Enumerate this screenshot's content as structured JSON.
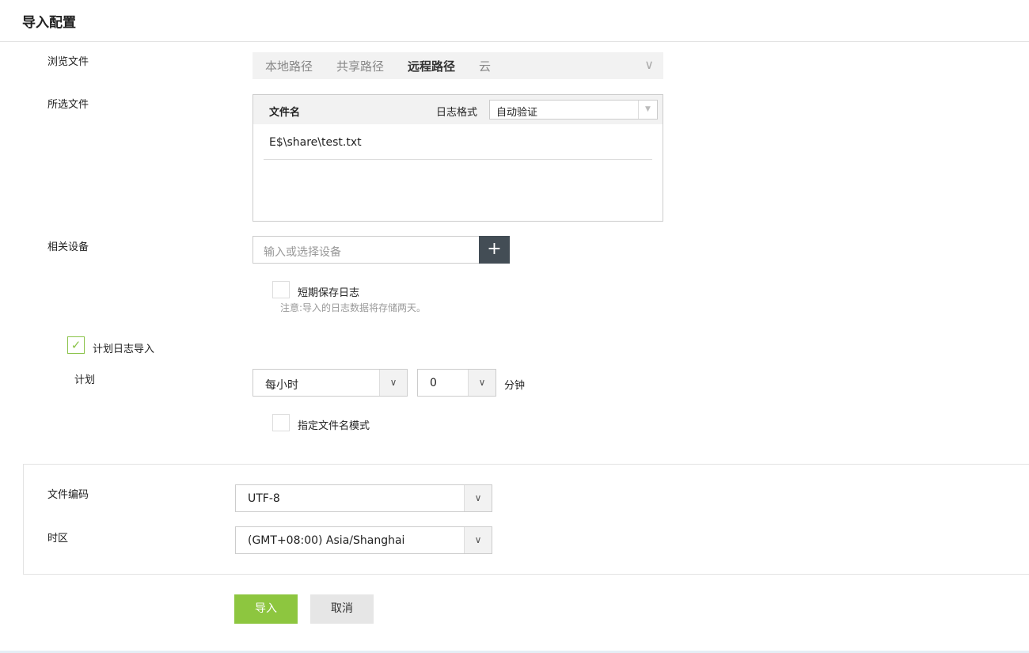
{
  "title": "导入配置",
  "labels": {
    "browse": "浏览文件",
    "selected": "所选文件",
    "device": "相关设备",
    "schedule": "计划",
    "encoding": "文件编码",
    "timezone": "时区"
  },
  "tabs": [
    {
      "label": "本地路径"
    },
    {
      "label": "共享路径"
    },
    {
      "label": "远程路径",
      "active": true
    },
    {
      "label": "云"
    }
  ],
  "file_table": {
    "col_filename": "文件名",
    "log_format_label": "日志格式",
    "log_format_value": "自动验证",
    "files": [
      "E$\\share\\test.txt"
    ]
  },
  "device_input": {
    "placeholder": "输入或选择设备",
    "value": ""
  },
  "short_term": {
    "label": "短期保存日志",
    "checked": false,
    "note": "注意:导入的日志数据将存储两天。"
  },
  "scheduled": {
    "label": "计划日志导入",
    "checked": true
  },
  "schedule": {
    "frequency": "每小时",
    "minute": "0",
    "minute_unit": "分钟"
  },
  "filename_pattern": {
    "label": "指定文件名模式",
    "checked": false
  },
  "encoding": "UTF-8",
  "timezone": "(GMT+08:00) Asia/Shanghai",
  "buttons": {
    "import": "导入",
    "cancel": "取消"
  },
  "colors": {
    "primary": "#8dc63f",
    "dark": "#434d55"
  }
}
